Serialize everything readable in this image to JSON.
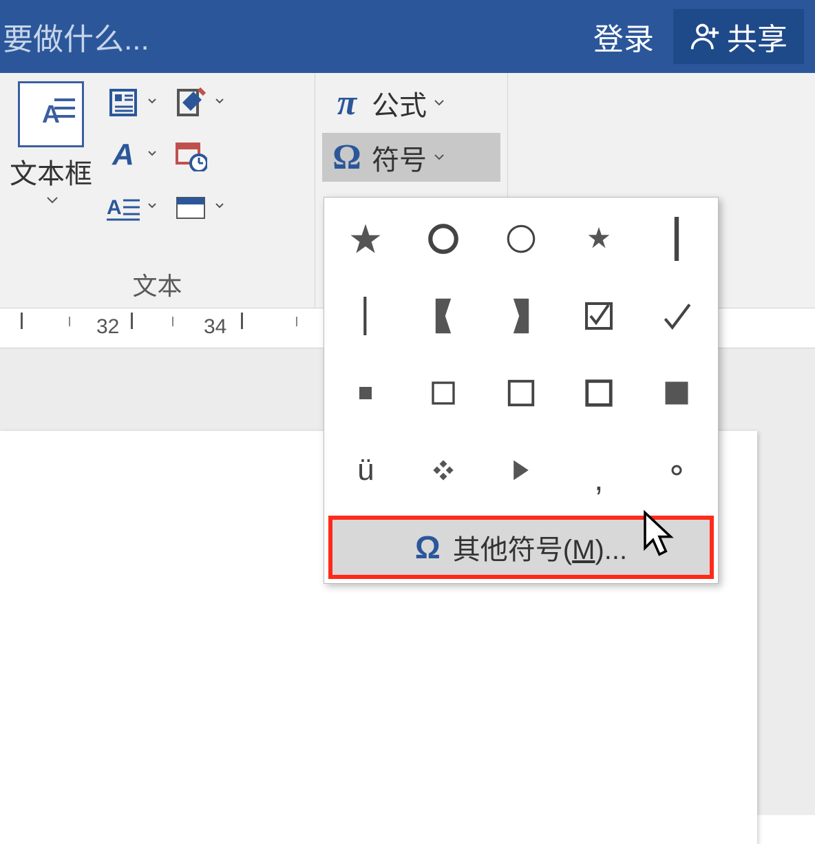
{
  "title_bar": {
    "tell_me": "要做什么...",
    "login": "登录",
    "share": "共享"
  },
  "ribbon": {
    "text_group": {
      "label": "文本",
      "textbox": "文本框"
    },
    "symbol_group": {
      "equation": "公式",
      "symbol": "符号"
    }
  },
  "ruler": {
    "marks": [
      "32",
      "34"
    ]
  },
  "symbol_panel": {
    "symbols": [
      "★",
      "○",
      "○",
      "⋆",
      "│",
      "│",
      "❳",
      "❲",
      "☑",
      "✓",
      "▪",
      "□",
      "□",
      "□",
      "■",
      "ü",
      "❖",
      "▶",
      ",",
      "∘"
    ],
    "more_prefix": "其他符号(",
    "more_mnem": "M",
    "more_suffix": ")..."
  }
}
